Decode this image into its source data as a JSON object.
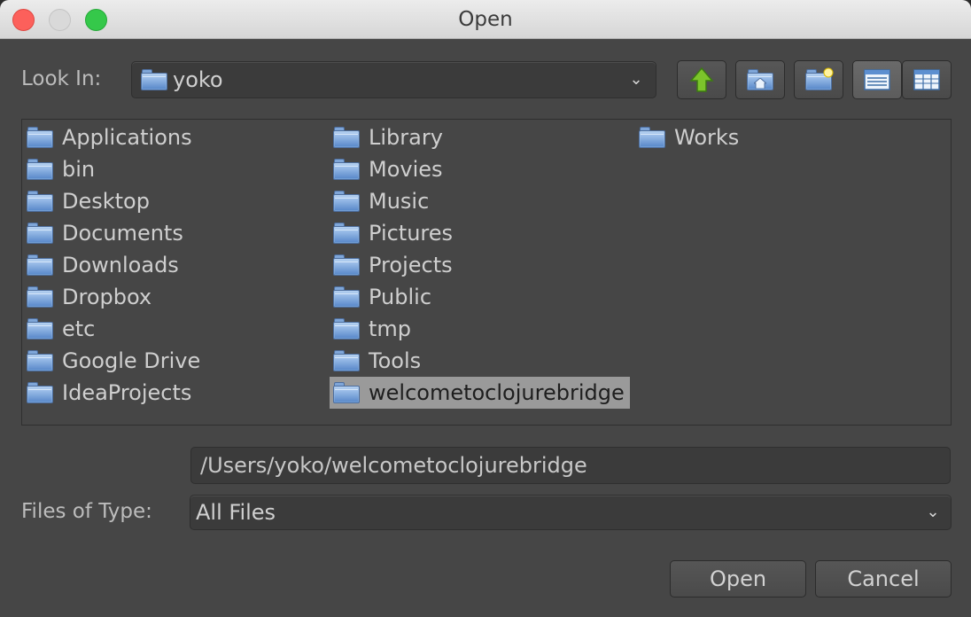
{
  "window": {
    "title": "Open"
  },
  "look_in": {
    "label": "Look In:",
    "value": "yoko"
  },
  "toolbar": {
    "icons": [
      "up-one-level-icon",
      "home-icon",
      "new-folder-icon",
      "list-view-icon",
      "details-view-icon"
    ]
  },
  "files": {
    "columns": [
      [
        "Applications",
        "bin",
        "Desktop",
        "Documents",
        "Downloads",
        "Dropbox",
        "etc",
        "Google Drive",
        "IdeaProjects"
      ],
      [
        "Library",
        "Movies",
        "Music",
        "Pictures",
        "Projects",
        "Public",
        "tmp",
        "Tools",
        "welcometoclojurebridge"
      ],
      [
        "Works"
      ]
    ],
    "selected": "welcometoclojurebridge"
  },
  "file_name": {
    "value": "/Users/yoko/welcometoclojurebridge"
  },
  "files_of_type": {
    "label": "Files of Type:",
    "value": "All Files"
  },
  "buttons": {
    "open": "Open",
    "cancel": "Cancel"
  },
  "colors": {
    "background": "#464646",
    "selection": "#9a9a9a",
    "folder": "#7fa6d8",
    "up_arrow": "#7cc52b"
  }
}
